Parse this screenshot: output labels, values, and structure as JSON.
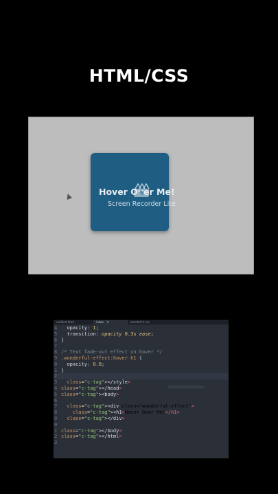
{
  "page_title": "HTML/CSS",
  "preview": {
    "card_text": "Hover Over Me!",
    "watermark_text": "Screen Recorder Lite",
    "watermark_icon": "film-reel-icon"
  },
  "editor": {
    "tabs": [
      {
        "label": "untitled.html",
        "active": false
      },
      {
        "label": "index",
        "active": true
      },
      {
        "label": "wonderful.css",
        "active": false
      }
    ],
    "lines": [
      {
        "num": "4",
        "text": "  opacity: 1;"
      },
      {
        "num": "5",
        "text": "  transition: opacity 0.3s ease;"
      },
      {
        "num": "6",
        "text": "}"
      },
      {
        "num": "7",
        "text": ""
      },
      {
        "num": "8",
        "text": "/* Text fade-out effect on hover */"
      },
      {
        "num": "9",
        "text": ".wonderful-effect:hover h1 {"
      },
      {
        "num": "0",
        "text": "  opacity: 0.8;"
      },
      {
        "num": "1",
        "text": "}"
      },
      {
        "num": "2",
        "text": ""
      },
      {
        "num": "3",
        "text": "  </style>"
      },
      {
        "num": "4",
        "text": "</head>"
      },
      {
        "num": "5",
        "text": "<body>"
      },
      {
        "num": "6",
        "text": ""
      },
      {
        "num": "7",
        "text": "  <div class=\"wonderful-effect\">"
      },
      {
        "num": "8",
        "text": "    <h1>Hover Over Me!</h1>"
      },
      {
        "num": "9",
        "text": "  </div>"
      },
      {
        "num": "0",
        "text": ""
      },
      {
        "num": "1",
        "text": "</body>"
      },
      {
        "num": "2",
        "text": "</html>"
      },
      {
        "num": "3",
        "text": ""
      }
    ]
  }
}
